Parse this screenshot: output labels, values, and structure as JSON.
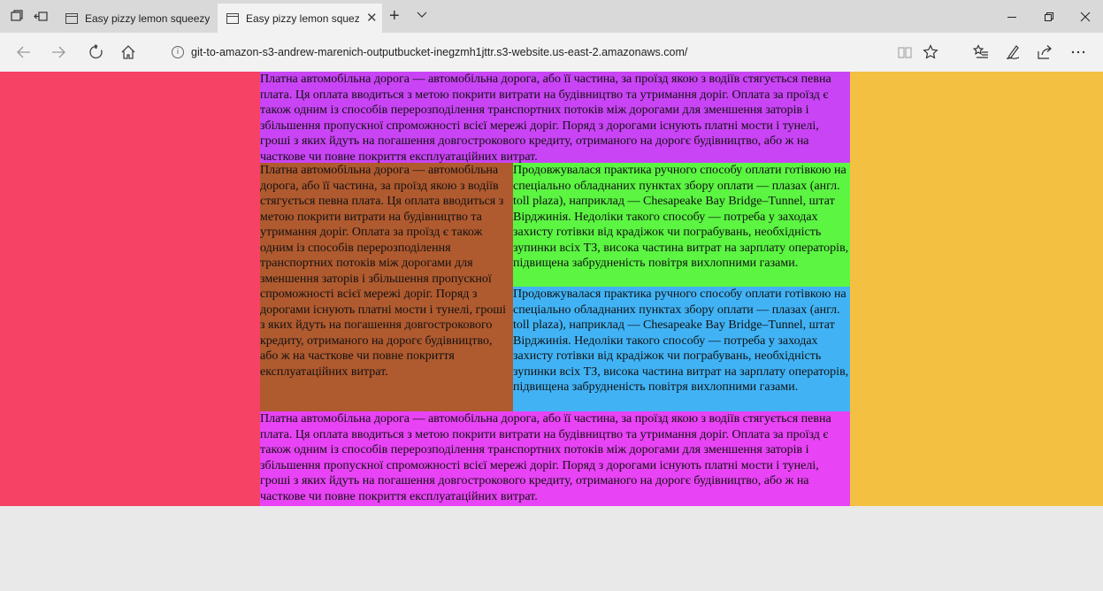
{
  "browser": {
    "tabs": [
      {
        "title": "Easy pizzy lemon squeezy",
        "active": false
      },
      {
        "title": "Easy pizzy lemon squez",
        "active": true
      }
    ],
    "new_tab_label": "+",
    "close_tab_label": "✕",
    "url": "git-to-amazon-s3-andrew-marenich-outputbucket-inegzmh1jttr.s3-website.us-east-2.amazonaws.com/"
  },
  "page": {
    "para_long": "Платна автомобільна дорога — автомобільна дорога, або її частина, за проїзд якою з водіїв стягується певна плата. Ця оплата вводиться з метою покрити витрати на будівництво та утримання доріг. Оплата за проїзд є також одним із способів перерозподілення транспортних потоків між дорогами для зменшення заторів і збільшення пропускної спроможності всієї мережі доріг. Поряд з дорогами існують платні мости і тунелі, гроші з яких йдуть на погашення довгострокового кредиту, отриманого на дорогє будівництво, або ж на часткове чи повне покриття експлуатаційних витрат.",
    "para_practice": "Продовжувалася практика ручного способу оплати готівкою на спеціально обладнаних пунктах збору оплати — плазах (англ. toll plaza), наприклад — Chesapeake Bay Bridge–Tunnel, штат Вірджинія. Недоліки такого способу — потреба у заходах захисту готівки від крадіжок чи пограбувань, необхідність зупинки всіх ТЗ, висока частина витрат на зарплату операторів, підвищена забрудненість повітря вихлопними газами."
  },
  "colors": {
    "left": "#f54265",
    "right": "#f4c042",
    "top": "#c944f5",
    "brown": "#b05a2f",
    "green": "#5bf542",
    "blue": "#41b3f5",
    "bottom": "#e843f5"
  }
}
